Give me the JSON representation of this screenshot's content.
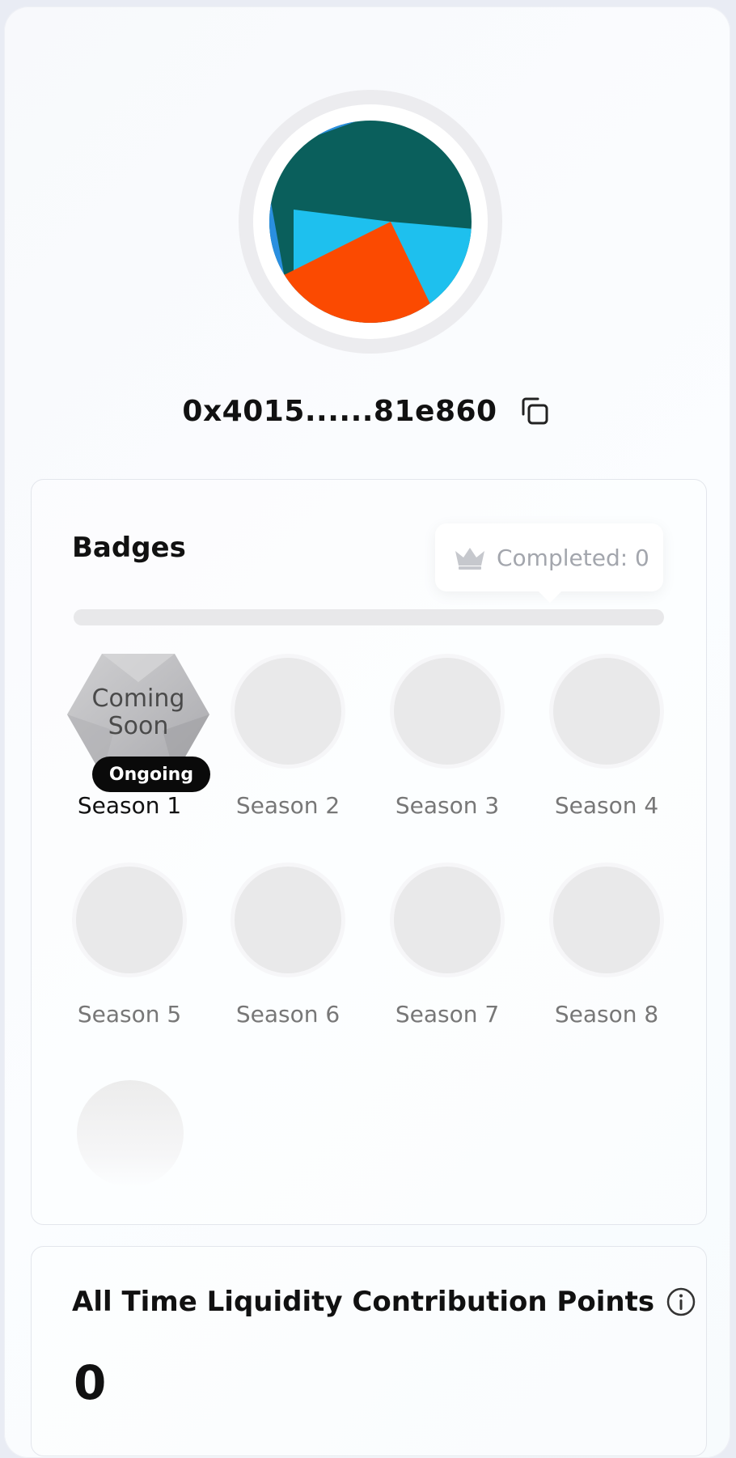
{
  "profile": {
    "address": "0x4015......81e860",
    "avatar_colors": [
      "#0a5f5c",
      "#1ec0ee",
      "#fb4a01",
      "#2a8fe0"
    ],
    "copy_icon": "copy-icon"
  },
  "badges": {
    "title": "Badges",
    "completed_label": "Completed: 0",
    "completed_icon": "crown-icon",
    "progress_fraction": 0,
    "items": [
      {
        "label": "Season 1",
        "status": "Ongoing",
        "image_text_1": "Coming",
        "image_text_2": "Soon"
      },
      {
        "label": "Season 2"
      },
      {
        "label": "Season 3"
      },
      {
        "label": "Season 4"
      },
      {
        "label": "Season 5"
      },
      {
        "label": "Season 6"
      },
      {
        "label": "Season 7"
      },
      {
        "label": "Season 8"
      }
    ]
  },
  "points": {
    "title": "All Time Liquidity Contribution Points",
    "info_icon": "info-icon",
    "value": "0"
  }
}
